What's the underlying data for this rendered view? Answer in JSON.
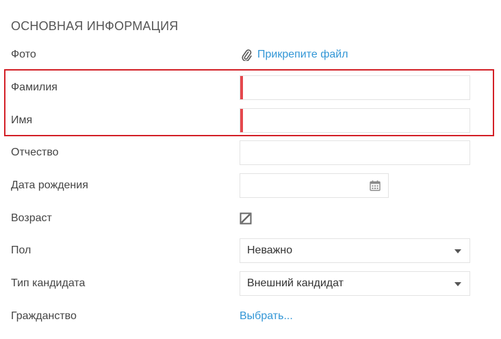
{
  "section": {
    "title": "ОСНОВНАЯ ИНФОРМАЦИЯ"
  },
  "photo": {
    "label": "Фото",
    "attach_link": "Прикрепите файл",
    "icon": "paperclip-icon"
  },
  "last_name": {
    "label": "Фамилия",
    "value": "",
    "required": true
  },
  "first_name": {
    "label": "Имя",
    "value": "",
    "required": true
  },
  "middle_name": {
    "label": "Отчество",
    "value": ""
  },
  "birth_date": {
    "label": "Дата рождения",
    "value": "",
    "icon": "calendar-icon"
  },
  "age": {
    "label": "Возраст",
    "checkbox_state": "disabled"
  },
  "gender": {
    "label": "Пол",
    "selected": "Неважно"
  },
  "candidate_type": {
    "label": "Тип кандидата",
    "selected": "Внешний кандидат"
  },
  "citizenship": {
    "label": "Гражданство",
    "select_link": "Выбрать..."
  },
  "colors": {
    "required": "#e5484d",
    "highlight": "#d31f26",
    "link": "#3296d6"
  }
}
